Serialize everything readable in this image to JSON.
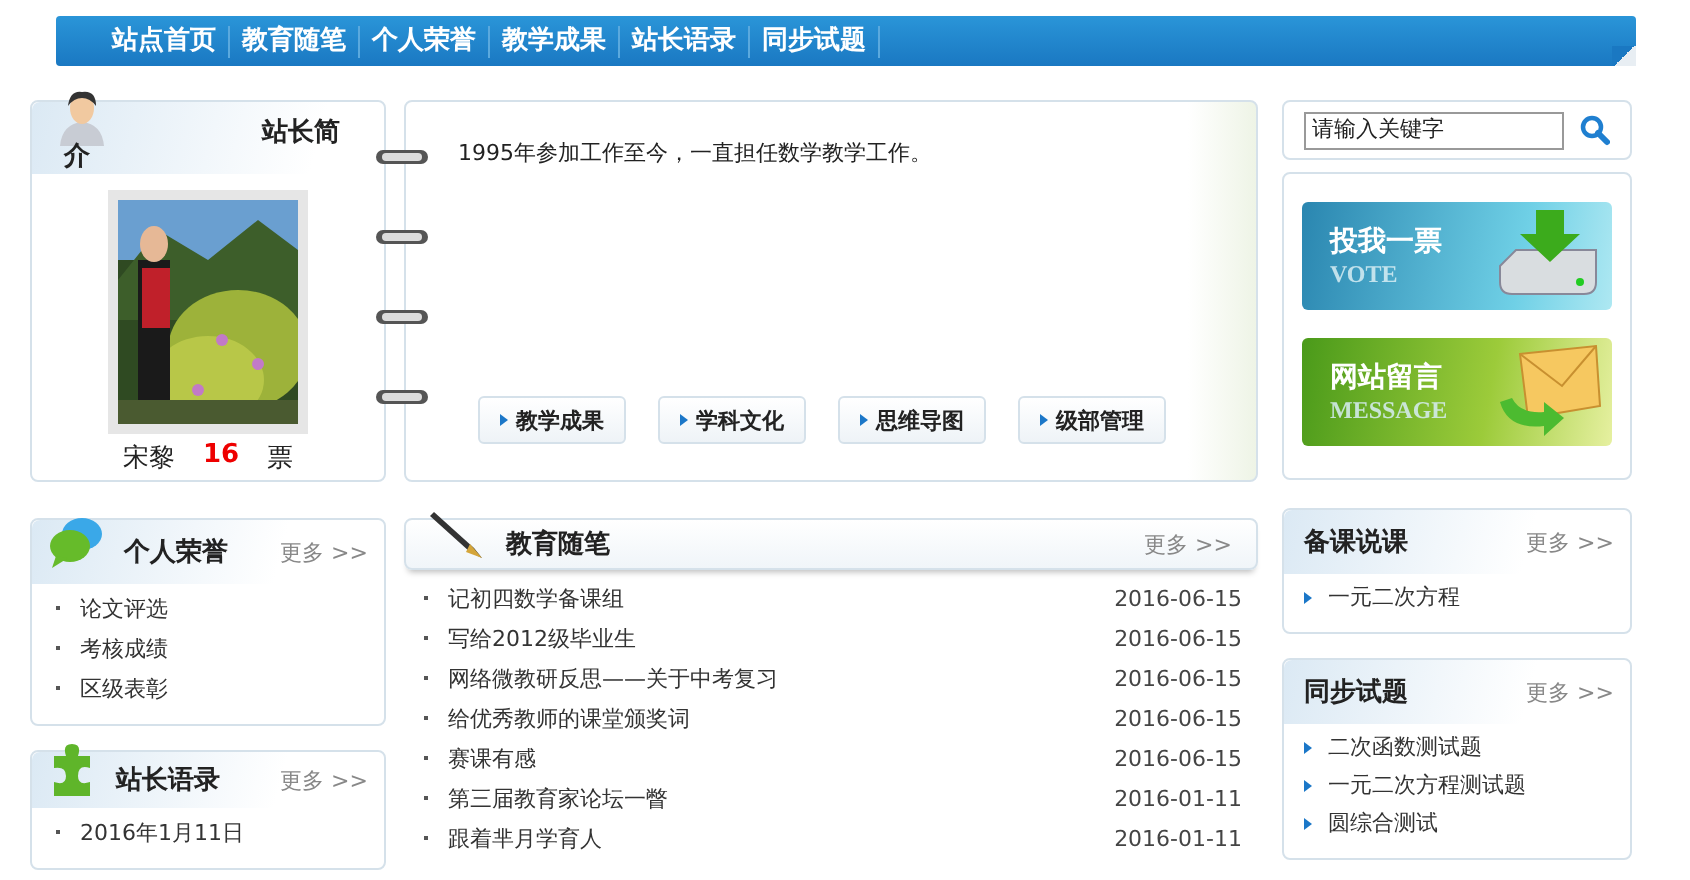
{
  "nav": [
    "站点首页",
    "教育随笔",
    "个人荣誉",
    "教学成果",
    "站长语录",
    "同步试题"
  ],
  "profile": {
    "title": "站长简",
    "title_tail": "介",
    "name": "宋黎",
    "votes": "16",
    "votes_unit": "票"
  },
  "intro": {
    "text": "1995年参加工作至今，一直担任数学教学工作。",
    "buttons": [
      "教学成果",
      "学科文化",
      "思维导图",
      "级部管理"
    ]
  },
  "search": {
    "placeholder": "请输入关键字"
  },
  "banners": [
    {
      "kind": "vote",
      "title": "投我一票",
      "subtitle": "VOTE"
    },
    {
      "kind": "message",
      "title": "网站留言",
      "subtitle": "MESSAGE"
    }
  ],
  "honors": {
    "title": "个人荣誉",
    "more": "更多 >>",
    "items": [
      "论文评选",
      "考核成绩",
      "区级表彰"
    ]
  },
  "quotes": {
    "title": "站长语录",
    "more": "更多 >>",
    "items": [
      "2016年1月11日"
    ]
  },
  "essays": {
    "title": "教育随笔",
    "more": "更多 >>",
    "rows": [
      {
        "title": "记初四数学备课组",
        "date": "2016-06-15"
      },
      {
        "title": "写给2012级毕业生",
        "date": "2016-06-15"
      },
      {
        "title": "网络微教研反思——关于中考复习",
        "date": "2016-06-15"
      },
      {
        "title": "给优秀教师的课堂颁奖词",
        "date": "2016-06-15"
      },
      {
        "title": "赛课有感",
        "date": "2016-06-15"
      },
      {
        "title": "第三届教育家论坛一瞥",
        "date": "2016-01-11"
      },
      {
        "title": "跟着芈月学育人",
        "date": "2016-01-11"
      }
    ]
  },
  "lessons": {
    "title": "备课说课",
    "more": "更多 >>",
    "items": [
      "一元二次方程"
    ]
  },
  "tests": {
    "title": "同步试题",
    "more": "更多 >>",
    "items": [
      "二次函数测试题",
      "一元二次方程测试题",
      "圆综合测试"
    ]
  }
}
